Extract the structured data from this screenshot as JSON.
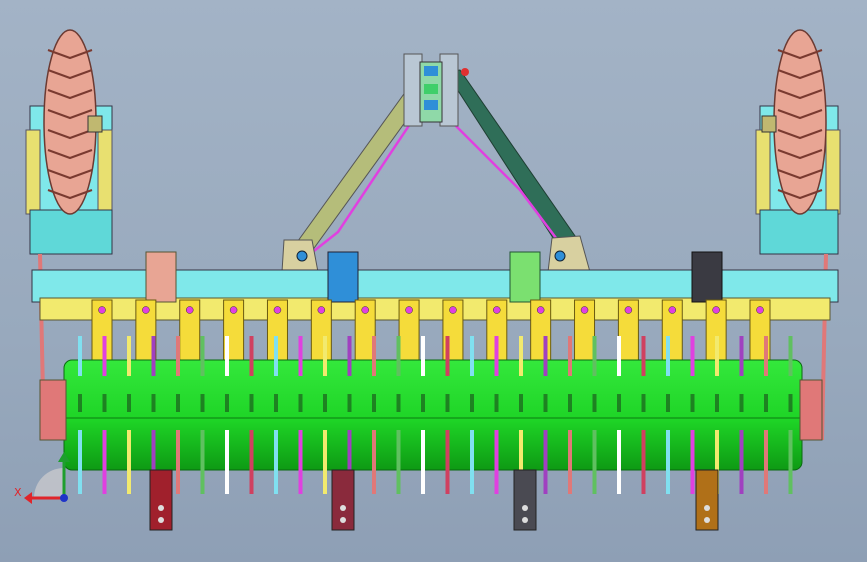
{
  "viewport": {
    "background_top": "#a3b3c6",
    "background_bottom": "#8e9fb5"
  },
  "triad": {
    "x_label": "X",
    "x_color": "#e0242a",
    "y_color": "#1e9e2e",
    "z_color": "#1e34c8"
  },
  "colors": {
    "roller": "#22d82c",
    "roller_dark": "#0e9a14",
    "beam_cyan": "#7fe8ea",
    "beam_yellow": "#f2ea6e",
    "tine": "#f5dc3a",
    "tire": "#e8a594",
    "link_left": "#b5bd7a",
    "link_right": "#2f6e58",
    "pink_rod": "#e040e0",
    "blue_part": "#2f8fd8"
  },
  "tine_count": 16,
  "shank_colors": [
    "#a0202c",
    "#8a2a3c",
    "#4a4a52",
    "#b07018"
  ]
}
